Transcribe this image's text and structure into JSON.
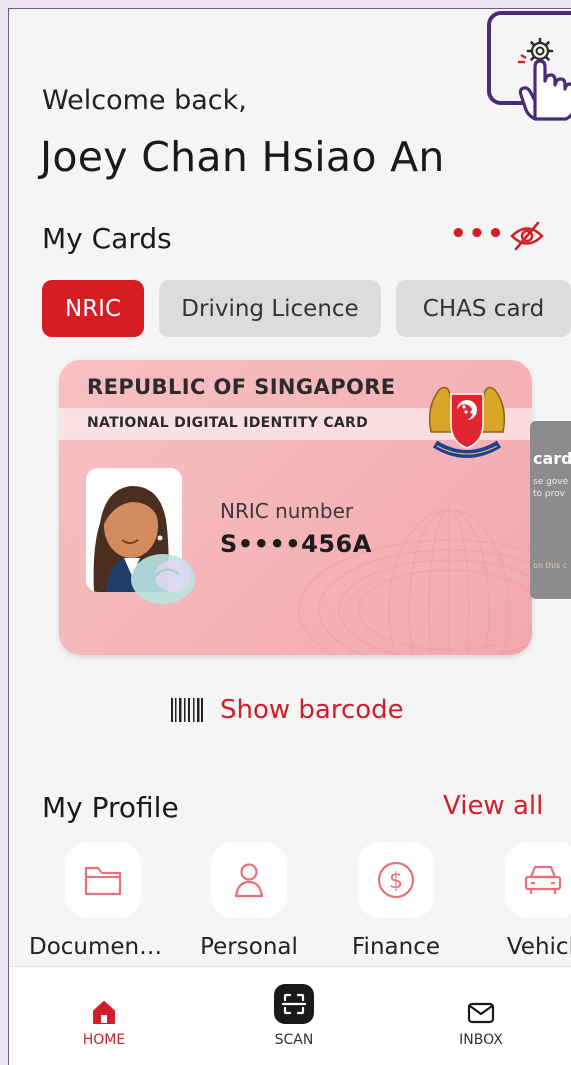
{
  "header": {
    "welcome": "Welcome back,",
    "user_name": "Joey Chan Hsiao An",
    "settings_icon": "gear-icon"
  },
  "my_cards": {
    "title": "My Cards",
    "more_icon": "more-dots-icon",
    "hide_icon": "eye-off-icon",
    "tabs": [
      {
        "label": "NRIC",
        "active": true
      },
      {
        "label": "Driving Licence",
        "active": false
      },
      {
        "label": "CHAS card",
        "active": false
      }
    ],
    "card": {
      "issuer": "REPUBLIC OF SINGAPORE",
      "type": "NATIONAL DIGITAL IDENTITY CARD",
      "number_label": "NRIC number",
      "number_value": "S••••456A"
    },
    "next_card": {
      "title": "card",
      "text_line1": "se gove",
      "text_line2": "to prov",
      "footer": "on this c"
    },
    "barcode_label": "Show barcode"
  },
  "my_profile": {
    "title": "My Profile",
    "view_all": "View all",
    "items": [
      {
        "label": "Documen…",
        "icon": "folder-icon"
      },
      {
        "label": "Personal",
        "icon": "person-icon"
      },
      {
        "label": "Finance",
        "icon": "dollar-icon"
      },
      {
        "label": "Vehicle",
        "icon": "car-icon"
      }
    ]
  },
  "bottom_nav": {
    "items": [
      {
        "label": "HOME",
        "icon": "home-icon",
        "active": true
      },
      {
        "label": "SCAN",
        "icon": "scan-icon",
        "active": false
      },
      {
        "label": "INBOX",
        "icon": "inbox-icon",
        "active": false
      }
    ]
  },
  "colors": {
    "accent": "#d71d24",
    "highlight_frame": "#4a2a7a",
    "card_pink": "#f4b3b6",
    "background": "#f5f5f5"
  }
}
